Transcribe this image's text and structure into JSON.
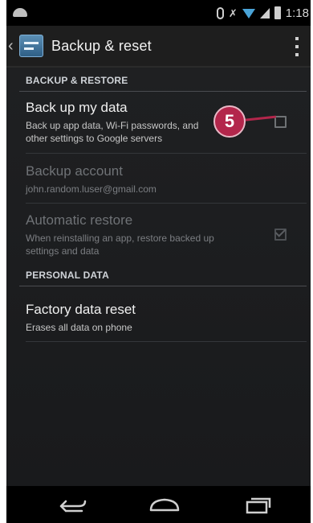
{
  "status_bar": {
    "time": "1:18",
    "icons": [
      "android-icon",
      "bluetooth-icon",
      "mute-icon",
      "wifi-icon",
      "signal-icon",
      "battery-icon"
    ]
  },
  "action_bar": {
    "back_glyph": "‹",
    "title": "Backup & reset"
  },
  "sections": {
    "backup_restore": {
      "header": "BACKUP & RESTORE",
      "backup_data": {
        "title": "Back up my data",
        "summary_line1": "Back up app data, Wi-Fi passwords, and",
        "summary_line2": "other settings to Google servers",
        "checked": false
      },
      "backup_account": {
        "title": "Backup account",
        "summary": "john.random.luser@gmail.com"
      },
      "auto_restore": {
        "title": "Automatic restore",
        "summary_line1": "When reinstalling an app, restore backed up",
        "summary_line2": "settings and data",
        "checked": true
      }
    },
    "personal_data": {
      "header": "PERSONAL DATA",
      "factory_reset": {
        "title": "Factory data reset",
        "summary": "Erases all data on phone"
      }
    }
  },
  "callout": {
    "label": "5",
    "color": "#b3264b"
  },
  "colors": {
    "background": "#1f2022",
    "action_bar": "#1e1e1e",
    "wifi_accent": "#4aa4d8"
  }
}
